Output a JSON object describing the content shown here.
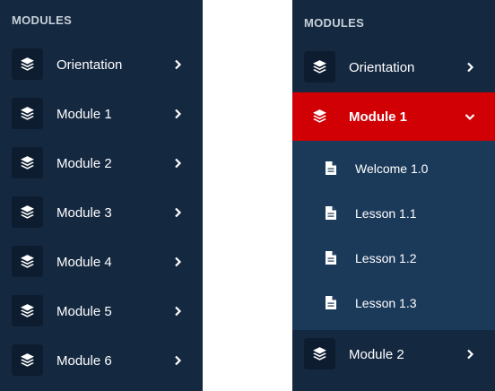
{
  "colors": {
    "panel_bg": "#142840",
    "submenu_bg": "#1b3a5a",
    "icon_box_bg": "#0d1d2f",
    "active_bg": "#d10005",
    "text": "#ffffff",
    "header_text": "#c7cfd9"
  },
  "left_menu": {
    "header": "MODULES",
    "items": [
      {
        "label": "Orientation",
        "icon": "layers-icon",
        "chevron": "chevron-right-icon"
      },
      {
        "label": "Module 1",
        "icon": "layers-icon",
        "chevron": "chevron-right-icon"
      },
      {
        "label": "Module 2",
        "icon": "layers-icon",
        "chevron": "chevron-right-icon"
      },
      {
        "label": "Module 3",
        "icon": "layers-icon",
        "chevron": "chevron-right-icon"
      },
      {
        "label": "Module 4",
        "icon": "layers-icon",
        "chevron": "chevron-right-icon"
      },
      {
        "label": "Module 5",
        "icon": "layers-icon",
        "chevron": "chevron-right-icon"
      },
      {
        "label": "Module 6",
        "icon": "layers-icon",
        "chevron": "chevron-right-icon"
      }
    ]
  },
  "right_menu": {
    "header": "MODULES",
    "items": [
      {
        "label": "Orientation",
        "icon": "layers-icon",
        "chevron": "chevron-right-icon"
      },
      {
        "label": "Module 1",
        "icon": "layers-icon",
        "chevron": "chevron-down-icon",
        "expanded": true,
        "children": [
          {
            "label": "Welcome 1.0",
            "icon": "document-icon"
          },
          {
            "label": "Lesson 1.1",
            "icon": "document-icon"
          },
          {
            "label": "Lesson 1.2",
            "icon": "document-icon"
          },
          {
            "label": "Lesson 1.3",
            "icon": "document-icon"
          }
        ]
      },
      {
        "label": "Module 2",
        "icon": "layers-icon",
        "chevron": "chevron-right-icon"
      }
    ]
  }
}
